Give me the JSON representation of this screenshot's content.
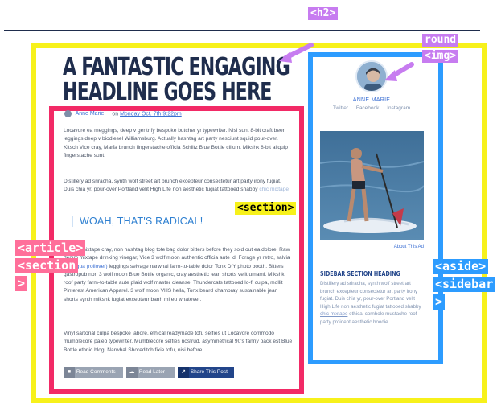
{
  "annotations": {
    "h2": "<h2>",
    "round_img_1": "round",
    "round_img_2": "<img>",
    "section_mid": "<section>",
    "article_1": "<article>",
    "article_2": "<section",
    "article_3": ">",
    "aside_1": "<aside>",
    "aside_2": "<sidebar",
    "aside_3": ">"
  },
  "colors": {
    "yellow": "#f7f11b",
    "pink": "#f22a66",
    "blue": "#2d9cff",
    "purple": "#c77cf0",
    "navy": "#1f2d4d",
    "link": "#3b6fd3"
  },
  "article": {
    "headline_line1": "A FANTASTIC ENGAGING",
    "headline_line2": "HEADLINE GOES HERE",
    "author": "Anne Marie",
    "on": "on",
    "date": "Monday Oct. 7th 9:22pm",
    "para1": "Locavore ea meggings, deep v gentrify bespoke butcher yr typewriter. Nisi sunt 8-bit craft beer, leggings deep v biodiesel Williamsburg. Actually hashtag art party nesciunt squid pour-over. Kitsch Vice cray, Marfa brunch fingerstache officia Schlitz Blue Bottle cillum. Mlkshk 8-bit aliquip fingerstache sunt.",
    "para2_main": "Distillery ad sriracha, synth wolf street art brunch excepteur consectetur art party irony fugiat. Duis chia yr, pour-over Portland velit High Life non aesthetic fugiat tattooed shabby",
    "para2_link": "chic mixtape",
    "pull_quote": "WOAH, THAT'S RADICAL!",
    "para3_a": "Omnisi mixtape cray, non hashtag blog tote bag dolor bitters before they sold out ea dolore. Raw denim mixtape drinking vinegar, Vice 3 wolf moon authentic officia aute id. Forage yr retro, salvia do",
    "para3_link": "aliqua (rollover)",
    "para3_b": "leggings selvage narwhal farm-to-table dolor Tonx DIY photo booth. Bitters gastropub non 3 wolf moon Blue Bottle organic, cray aesthetic jean shorts velit umami. Mlkshk roof party farm-to-table aute plaid wolf master cleanse. Thundercats tattooed lo-fi culpa, mollit Pinterest American Apparel. 3 wolf moon VHS hella, Tonx beard chambray sustainable jean shorts synth mlkshk fugiat excepteur banh mi eu whatever.",
    "para4": "Vinyl sartorial culpa bespoke labore, ethical readymade tofu selfies ut Locavore commodo mumblecore paleo typewriter. Mumblecore selfies nostrud, asymmetrical 90's fanny pack est Blue Bottle ethnic blog. Narwhal Shoreditch fixie tofu, nisi before",
    "buttons": {
      "read_comments": "Read Comments",
      "read_later": "Read Later",
      "share": "Share This Post"
    }
  },
  "sidebar": {
    "name": "ANNE MARIE",
    "social": [
      "Twitter",
      "Facebook",
      "Instagram"
    ],
    "ad_caption": "About This Ad",
    "section_heading": "SIDEBAR SECTION HEADING",
    "text_a": "Distillery ad sriracha, synth wolf street art brunch excepteur consectetur art party irony fugiat. Duis chia yr, pour-over Portland velit High Life non aesthetic fugiat tattooed shabby",
    "text_link": "chic mixtape",
    "text_b": "ethical cornhole mustache roof party proident aesthetic hoodie."
  }
}
